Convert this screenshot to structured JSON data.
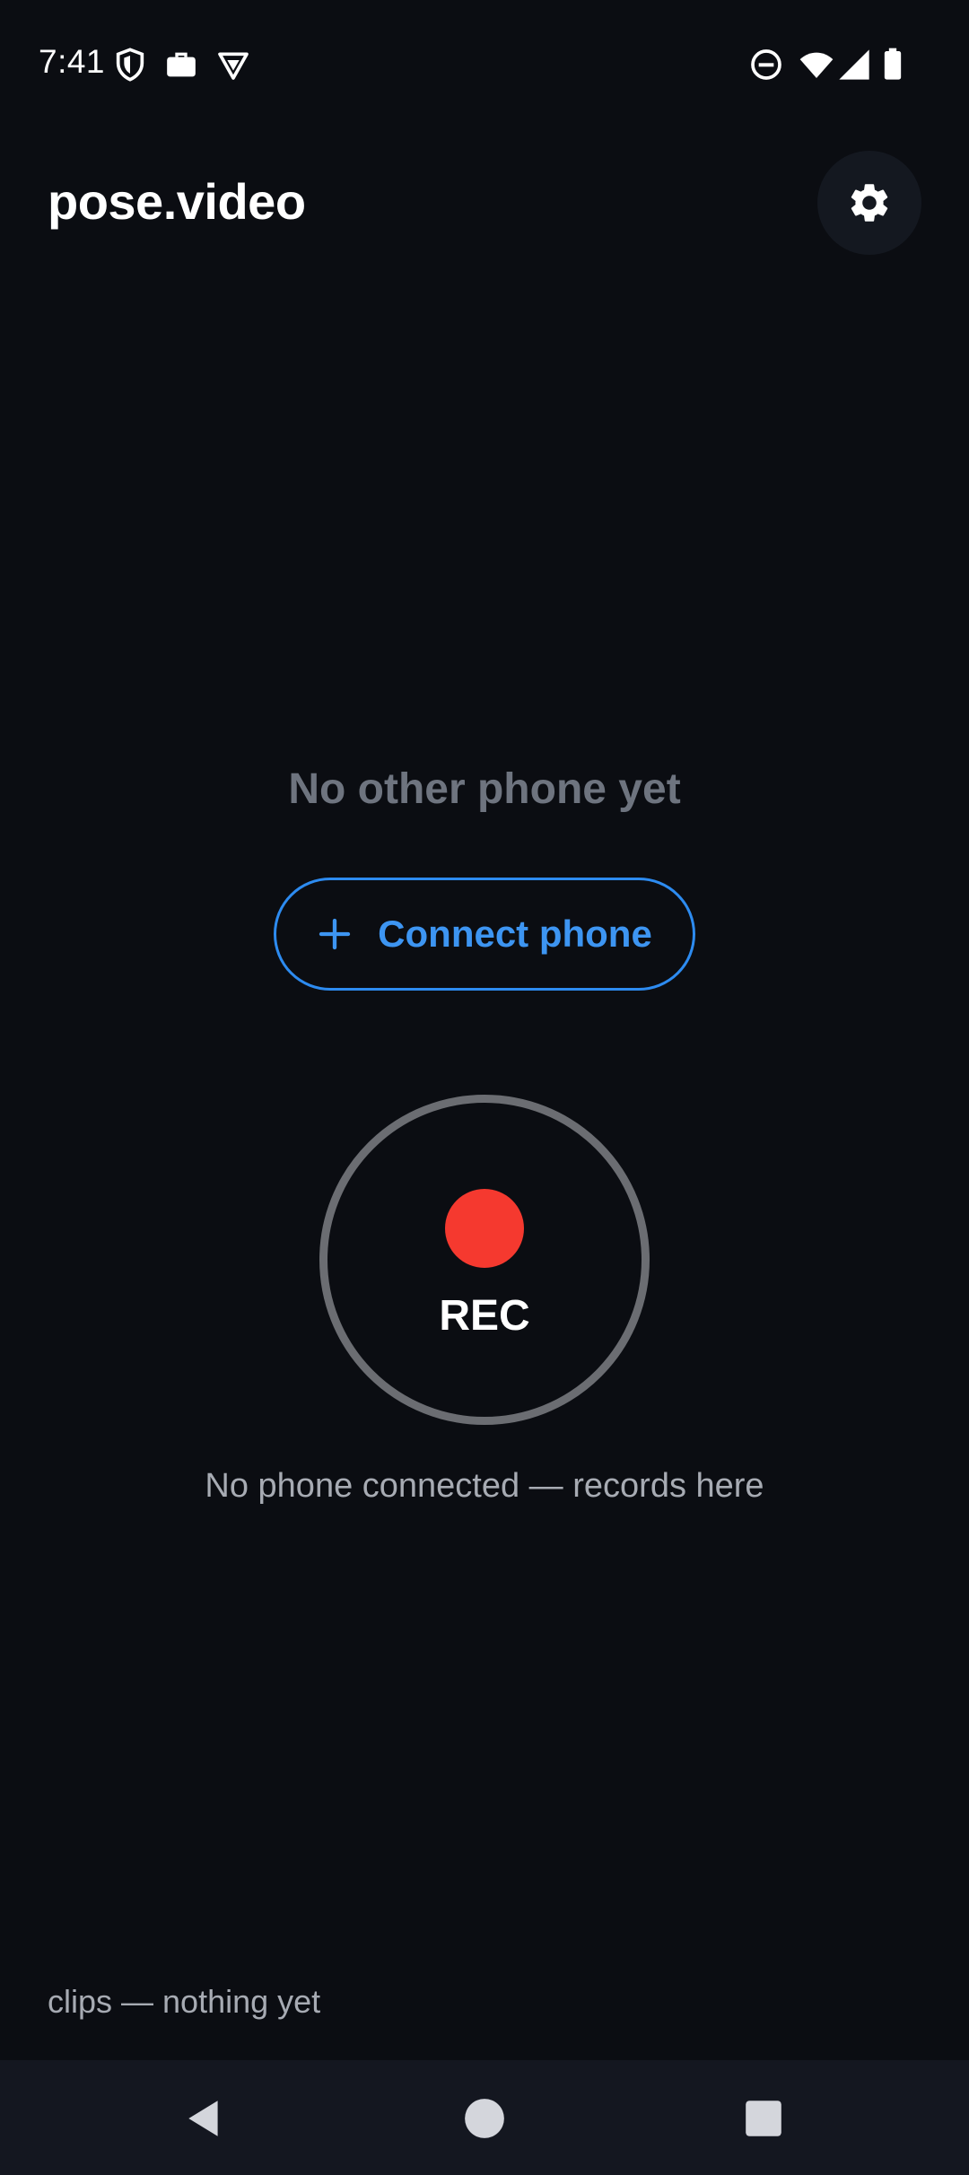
{
  "status_bar": {
    "time": "7:41",
    "left_icons": [
      "shield-icon",
      "briefcase-icon",
      "vpn-icon"
    ],
    "right_icons": [
      "do-not-disturb-icon",
      "wifi-icon",
      "signal-icon",
      "battery-icon"
    ]
  },
  "header": {
    "title": "pose.video",
    "settings_icon": "gear-icon"
  },
  "main": {
    "empty_title": "No other phone yet",
    "connect_button_label": "Connect phone",
    "connect_button_icon": "plus-icon",
    "rec_label": "REC",
    "rec_status": "No phone connected — records here"
  },
  "footer": {
    "clips_status": "clips — nothing yet"
  },
  "nav_bar": {
    "buttons": [
      "back-icon",
      "home-icon",
      "recents-icon"
    ]
  },
  "colors": {
    "background": "#0b0d12",
    "accent": "#3d95f2",
    "record": "#f5392f",
    "ring": "#6b6d72",
    "muted_text": "#6e747f"
  }
}
